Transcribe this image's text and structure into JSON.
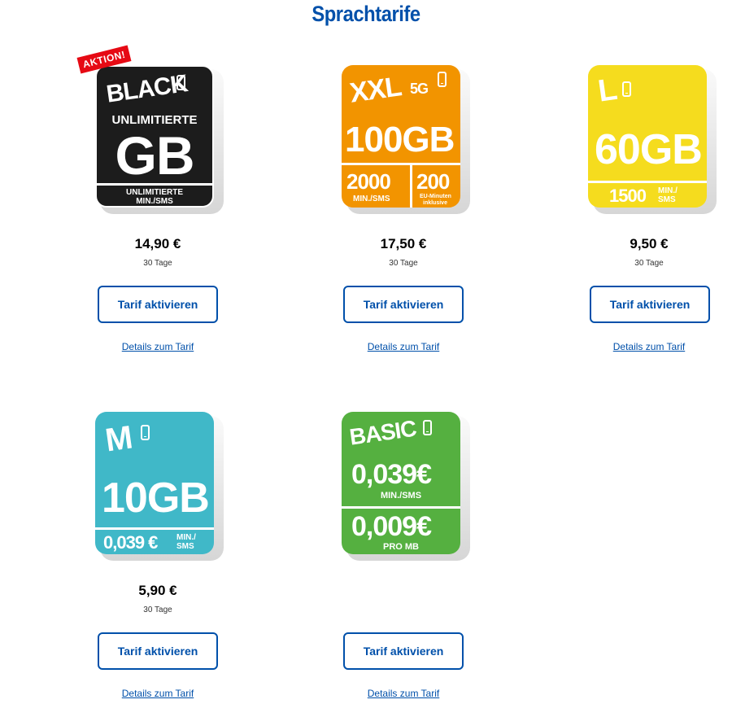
{
  "page": {
    "title": "Sprachtarife"
  },
  "common": {
    "button_label": "Tarif aktivieren",
    "details_label": "Details zum Tarif"
  },
  "colors": {
    "brand_blue": "#0050aa",
    "black": "#1c1c1c",
    "orange": "#f29400",
    "yellow": "#f5dc1e",
    "teal": "#40b8c8",
    "green": "#55b040",
    "badge_red": "#e60a14"
  },
  "tariffs": [
    {
      "name": "BLACK",
      "badge": "AKTION!",
      "line1": "UNLIMITIERTE",
      "big": "GB",
      "foot1": "UNLIMITIERTE",
      "foot2": "MIN./SMS",
      "price": "14,90 €",
      "period": "30 Tage",
      "icon": "smartphone-icon"
    },
    {
      "name": "XXL",
      "tag": "5G",
      "big": "100GB",
      "left_num": "2000",
      "left_unit": "MIN./SMS",
      "right_num": "200",
      "right_unit1": "EU-Minuten",
      "right_unit2": "inklusive",
      "price": "17,50 €",
      "period": "30 Tage",
      "icon": "smartphone-icon"
    },
    {
      "name": "L",
      "big": "60GB",
      "foot_num": "1500",
      "foot_unit1": "MIN./",
      "foot_unit2": "SMS",
      "price": "9,50 €",
      "period": "30 Tage",
      "icon": "smartphone-icon"
    },
    {
      "name": "M",
      "big": "10GB",
      "foot_num": "0,039 €",
      "foot_unit1": "MIN./",
      "foot_unit2": "SMS",
      "price": "5,90 €",
      "period": "30 Tage",
      "icon": "smartphone-icon"
    },
    {
      "name": "BASIC",
      "rate1": "0,039€",
      "rate1_unit": "MIN./SMS",
      "rate2": "0,009€",
      "rate2_unit": "PRO MB",
      "icon": "smartphone-icon"
    }
  ]
}
